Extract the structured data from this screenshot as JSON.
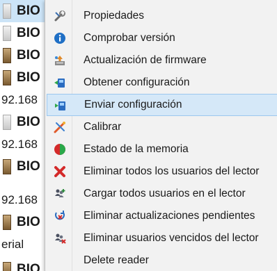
{
  "background_list": {
    "rows": [
      {
        "text": "BIO"
      },
      {
        "text": "BIO"
      },
      {
        "text": "BIO"
      },
      {
        "text": "BIO"
      },
      {
        "text": "92.168"
      },
      {
        "text": "BIO"
      },
      {
        "text": "92.168"
      },
      {
        "text": "BIO"
      },
      {
        "text": "92.168"
      },
      {
        "text": "BIO"
      },
      {
        "text": "erial"
      },
      {
        "text": "BIO"
      }
    ]
  },
  "context_menu": {
    "items": [
      {
        "label": "Propiedades",
        "icon": "wrench-icon"
      },
      {
        "label": "Comprobar versión",
        "icon": "info-icon"
      },
      {
        "label": "Actualización de firmware",
        "icon": "firmware-update-icon"
      },
      {
        "label": "Obtener configuración",
        "icon": "get-config-icon"
      },
      {
        "label": "Enviar configuración",
        "icon": "send-config-icon"
      },
      {
        "label": "Calibrar",
        "icon": "calibrate-icon"
      },
      {
        "label": "Estado de la memoria",
        "icon": "memory-pie-icon"
      },
      {
        "label": "Eliminar todos los usuarios del lector",
        "icon": "delete-x-icon"
      },
      {
        "label": "Cargar todos usuarios en el lector",
        "icon": "load-users-icon"
      },
      {
        "label": "Eliminar actualizaciones pendientes",
        "icon": "remove-pending-icon"
      },
      {
        "label": "Eliminar usuarios vencidos del lector",
        "icon": "remove-expired-users-icon"
      },
      {
        "label": "Delete reader",
        "icon": "none"
      }
    ],
    "highlighted_item": "Enviar configuración",
    "colors": {
      "menu_background": "#f2f2f2",
      "highlight_background": "#d5e8f8",
      "highlight_border": "#9bc7ee",
      "selected_row": "#cce4f7"
    }
  }
}
